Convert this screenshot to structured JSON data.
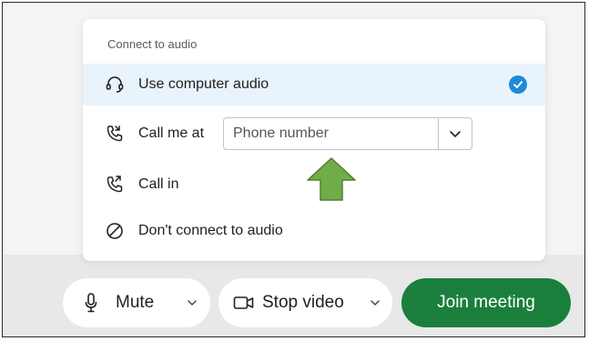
{
  "audio_panel": {
    "title": "Connect to audio",
    "options": [
      {
        "label": "Use computer audio",
        "icon": "headset-icon",
        "selected": true
      },
      {
        "label": "Call me at",
        "icon": "phone-outgoing-icon",
        "selected": false
      },
      {
        "label": "Call in",
        "icon": "phone-incoming-icon",
        "selected": false
      },
      {
        "label": "Don't connect to audio",
        "icon": "no-audio-icon",
        "selected": false
      }
    ],
    "phone_input": {
      "value": "",
      "placeholder": "Phone number"
    }
  },
  "toolbar": {
    "mute_label": "Mute",
    "video_label": "Stop video",
    "join_label": "Join meeting"
  },
  "colors": {
    "accent": "#1c8ad8",
    "join_green": "#1a7f3c",
    "selected_row": "#e9f3fc",
    "annotation_arrow": "#70ad47"
  }
}
